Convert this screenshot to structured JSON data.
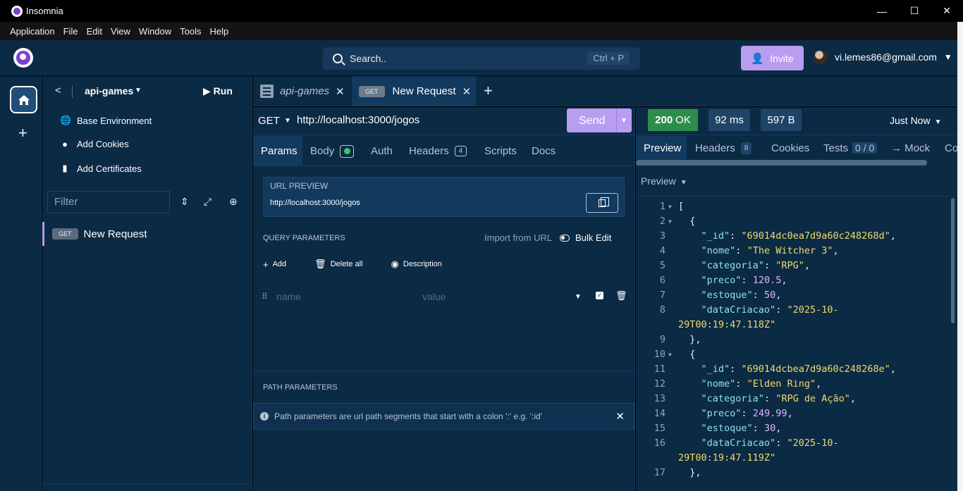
{
  "window": {
    "title": "Insomnia",
    "controls": [
      "—",
      "☐",
      "✕"
    ]
  },
  "menubar": [
    "Application",
    "File",
    "Edit",
    "View",
    "Window",
    "Tools",
    "Help"
  ],
  "header": {
    "search_placeholder": "Search..",
    "search_shortcut": "Ctrl + P",
    "invite_label": "Invite",
    "user_email": "vi.lemes86@gmail.com"
  },
  "sidebar": {
    "project": "api-games",
    "run_label": "Run",
    "menu": [
      {
        "label": "Base Environment",
        "icon": "globe-icon"
      },
      {
        "label": "Add Cookies",
        "icon": "cookie-icon"
      },
      {
        "label": "Add Certificates",
        "icon": "certificate-icon"
      }
    ],
    "filter_placeholder": "Filter",
    "requests": [
      {
        "method": "GET",
        "name": "New Request"
      }
    ]
  },
  "tabs": [
    {
      "label": "api-games",
      "type": "collection"
    },
    {
      "method": "GET",
      "label": "New Request",
      "active": true
    }
  ],
  "request": {
    "method": "GET",
    "url": "http://localhost:3000/jogos",
    "send_label": "Send",
    "tabs": [
      {
        "label": "Params",
        "active": true
      },
      {
        "label": "Body",
        "indicator": "green-dot"
      },
      {
        "label": "Auth"
      },
      {
        "label": "Headers",
        "count": "4"
      },
      {
        "label": "Scripts"
      },
      {
        "label": "Docs"
      }
    ],
    "url_preview_label": "URL PREVIEW",
    "url_preview_value": "http://localhost:3000/jogos",
    "query_params_label": "QUERY PARAMETERS",
    "import_from_url": "Import from URL",
    "bulk_edit": "Bulk Edit",
    "actions": {
      "add": "Add",
      "delete_all": "Delete all",
      "description": "Description"
    },
    "param_name_placeholder": "name",
    "param_value_placeholder": "value",
    "path_params_label": "PATH PARAMETERS",
    "path_params_info": "Path parameters are url path segments that start with a colon ':' e.g. ':id'"
  },
  "response": {
    "status_code": "200",
    "status_text": "OK",
    "time": "92 ms",
    "size": "597 B",
    "timestamp": "Just Now",
    "tabs": [
      {
        "label": "Preview",
        "active": true
      },
      {
        "label": "Headers",
        "count": "8"
      },
      {
        "label": "Cookies"
      },
      {
        "label": "Tests",
        "count": "0 / 0"
      },
      {
        "label": "→ Mock"
      },
      {
        "label": "Co"
      }
    ],
    "preview_selector": "Preview",
    "lines": [
      {
        "n": "1",
        "fold": true,
        "html": "["
      },
      {
        "n": "2",
        "fold": true,
        "html": "  {"
      },
      {
        "n": "3",
        "html": "    <span class=\"k\">\"_id\"</span>: <span class=\"s\">\"69014dc0ea7d9a60c248268d\"</span>,"
      },
      {
        "n": "4",
        "html": "    <span class=\"k\">\"nome\"</span>: <span class=\"s\">\"The Witcher 3\"</span>,"
      },
      {
        "n": "5",
        "html": "    <span class=\"k\">\"categoria\"</span>: <span class=\"s\">\"RPG\"</span>,"
      },
      {
        "n": "6",
        "html": "    <span class=\"k\">\"preco\"</span>: <span class=\"n\">120.5</span>,"
      },
      {
        "n": "7",
        "html": "    <span class=\"k\">\"estoque\"</span>: <span class=\"n\">50</span>,"
      },
      {
        "n": "8",
        "html": "    <span class=\"k\">\"dataCriacao\"</span>: <span class=\"s\">\"2025-10-</span>"
      },
      {
        "n": "",
        "html": "<span class=\"s\">29T00:19:47.118Z\"</span>"
      },
      {
        "n": "9",
        "html": "  },"
      },
      {
        "n": "10",
        "fold": true,
        "html": "  {"
      },
      {
        "n": "11",
        "html": "    <span class=\"k\">\"_id\"</span>: <span class=\"s\">\"69014dcbea7d9a60c248268e\"</span>,"
      },
      {
        "n": "12",
        "html": "    <span class=\"k\">\"nome\"</span>: <span class=\"s\">\"Elden Ring\"</span>,"
      },
      {
        "n": "13",
        "html": "    <span class=\"k\">\"categoria\"</span>: <span class=\"s\">\"RPG de Ação\"</span>,"
      },
      {
        "n": "14",
        "html": "    <span class=\"k\">\"preco\"</span>: <span class=\"n\">249.99</span>,"
      },
      {
        "n": "15",
        "html": "    <span class=\"k\">\"estoque\"</span>: <span class=\"n\">30</span>,"
      },
      {
        "n": "16",
        "html": "    <span class=\"k\">\"dataCriacao\"</span>: <span class=\"s\">\"2025-10-</span>"
      },
      {
        "n": "",
        "html": "<span class=\"s\">29T00:19:47.119Z\"</span>"
      },
      {
        "n": "17",
        "html": "  },"
      }
    ]
  },
  "colors": {
    "background": "#0b2a44",
    "accent": "#b89df0",
    "status_ok": "#2f8d4b",
    "json_key": "#8ee0f0",
    "json_string": "#f0d96a",
    "json_number": "#e8b0ff"
  }
}
